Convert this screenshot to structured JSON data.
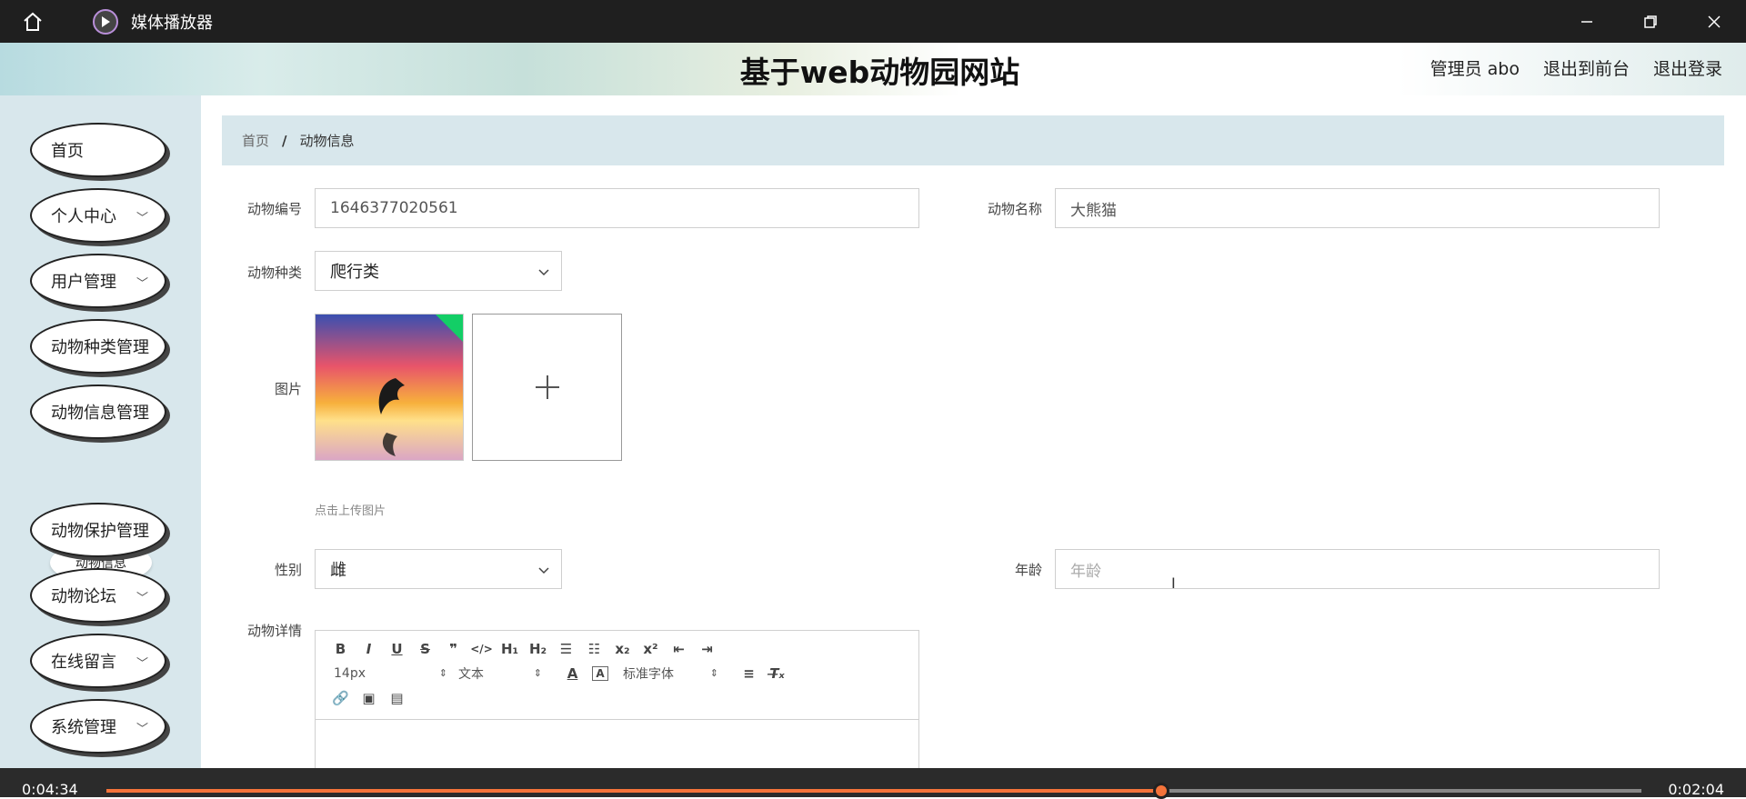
{
  "window": {
    "title": "媒体播放器"
  },
  "header": {
    "site_title": "基于web动物园网站",
    "user": "管理员 abo",
    "to_front": "退出到前台",
    "logout": "退出登录"
  },
  "sidebar": {
    "items": [
      {
        "label": "首页"
      },
      {
        "label": "个人中心"
      },
      {
        "label": "用户管理"
      },
      {
        "label": "动物种类管理"
      },
      {
        "label": "动物信息管理"
      },
      {
        "label": "动物保护管理"
      },
      {
        "label": "动物论坛"
      },
      {
        "label": "在线留言"
      },
      {
        "label": "系统管理"
      }
    ],
    "sub_item": "动物信息"
  },
  "breadcrumb": {
    "home": "首页",
    "sep": "/",
    "current": "动物信息"
  },
  "form": {
    "animal_no_label": "动物编号",
    "animal_no_value": "1646377020561",
    "animal_name_label": "动物名称",
    "animal_name_value": "大熊猫",
    "animal_type_label": "动物种类",
    "animal_type_value": "爬行类",
    "image_label": "图片",
    "upload_hint": "点击上传图片",
    "gender_label": "性别",
    "gender_value": "雌",
    "age_label": "年龄",
    "age_placeholder": "年龄",
    "detail_label": "动物详情"
  },
  "editor": {
    "font_size": "14px",
    "block_type": "文本",
    "font_family": "标准字体"
  },
  "player": {
    "elapsed": "0:04:34",
    "remaining": "0:02:04",
    "progress": 0.687
  },
  "colors": {
    "accent": "#f4733a",
    "sidebar_bg": "#d8e7ec",
    "success": "#13ce66"
  }
}
